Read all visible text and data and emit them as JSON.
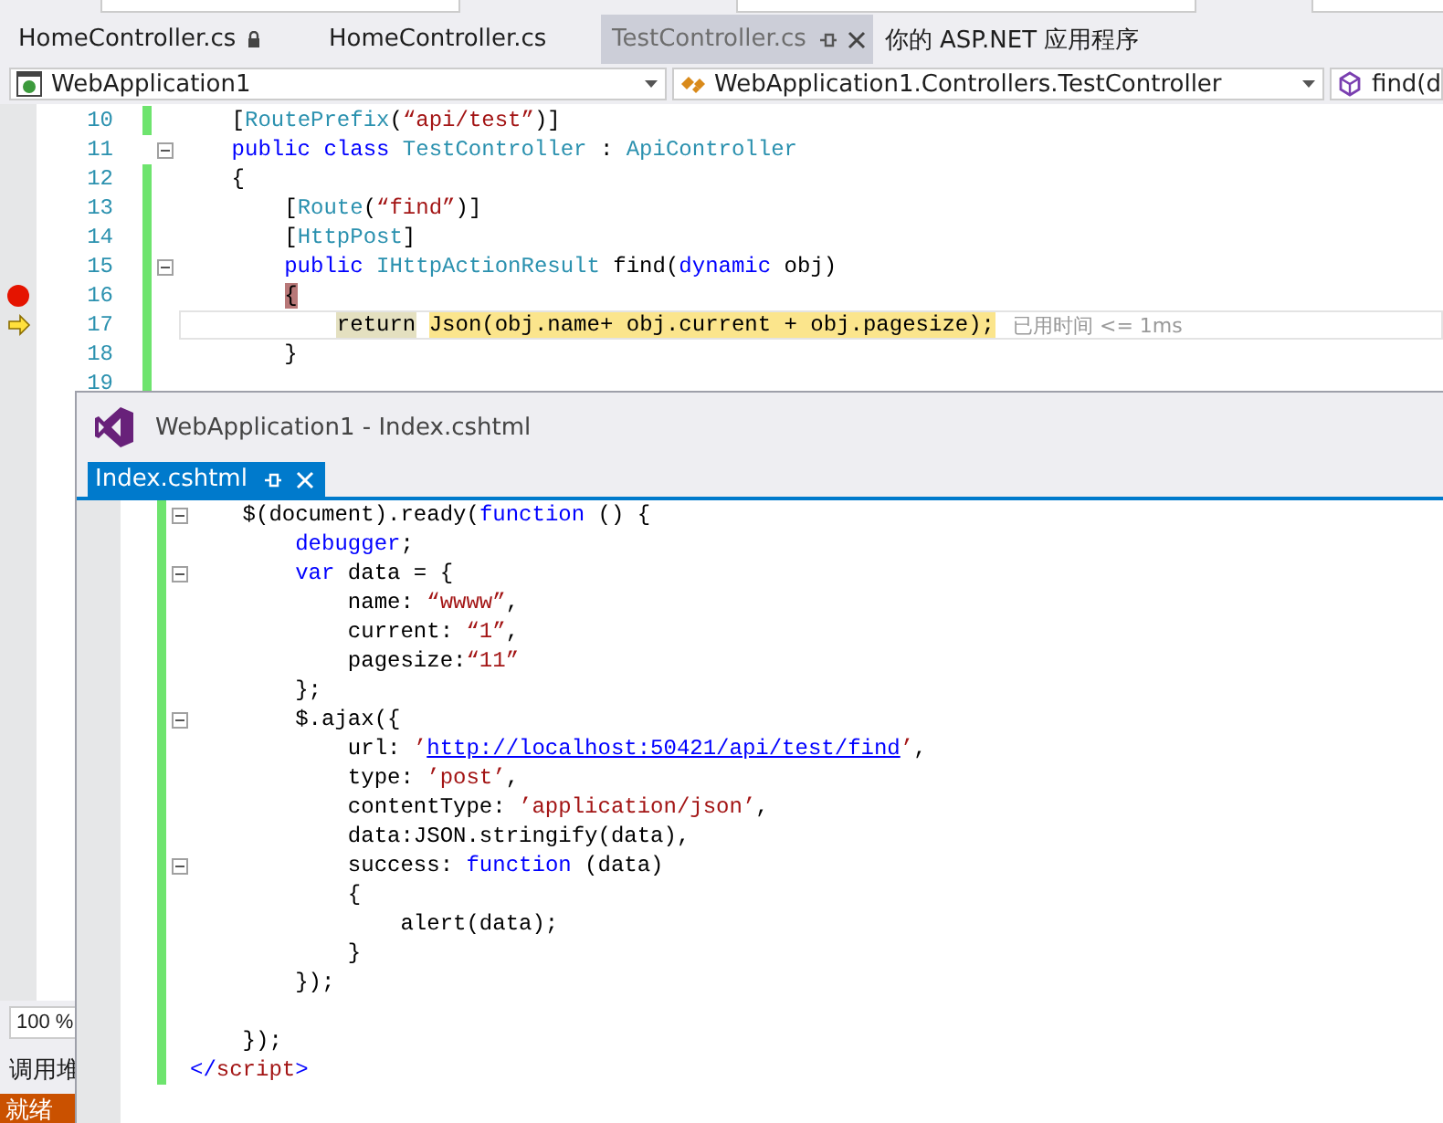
{
  "top_tabs": [
    {
      "label": "HomeController.cs",
      "locked": true,
      "selected": false
    },
    {
      "label": "HomeController.cs",
      "locked": false,
      "selected": false
    },
    {
      "label": "TestController.cs",
      "locked": false,
      "selected": true
    },
    {
      "label": "你的 ASP.NET 应用程序",
      "locked": false,
      "selected": false
    }
  ],
  "nav": {
    "project": "WebApplication1",
    "type": "WebApplication1.Controllers.TestController",
    "member": "find(d"
  },
  "editor": {
    "lines": [
      {
        "number": "10",
        "changed": true,
        "fold": false,
        "breakpoint": false,
        "current": false,
        "tokens": [
          {
            "text": "    [",
            "kind": "plain"
          },
          {
            "text": "RoutePrefix",
            "kind": "type"
          },
          {
            "text": "(",
            "kind": "plain"
          },
          {
            "text": "“api/test”",
            "kind": "string"
          },
          {
            "text": ")]",
            "kind": "plain"
          }
        ]
      },
      {
        "number": "11",
        "changed": false,
        "fold": true,
        "breakpoint": false,
        "current": false,
        "tokens": [
          {
            "text": "    public class ",
            "kind": "keyword"
          },
          {
            "text": "TestController",
            "kind": "type"
          },
          {
            "text": " : ",
            "kind": "plain"
          },
          {
            "text": "ApiController",
            "kind": "type"
          }
        ]
      },
      {
        "number": "12",
        "changed": true,
        "fold": false,
        "breakpoint": false,
        "current": false,
        "tokens": [
          {
            "text": "    {",
            "kind": "plain"
          }
        ]
      },
      {
        "number": "13",
        "changed": true,
        "fold": false,
        "breakpoint": false,
        "current": false,
        "tokens": [
          {
            "text": "        [",
            "kind": "plain"
          },
          {
            "text": "Route",
            "kind": "type"
          },
          {
            "text": "(",
            "kind": "plain"
          },
          {
            "text": "“find”",
            "kind": "string"
          },
          {
            "text": ")]",
            "kind": "plain"
          }
        ]
      },
      {
        "number": "14",
        "changed": true,
        "fold": false,
        "breakpoint": false,
        "current": false,
        "tokens": [
          {
            "text": "        [",
            "kind": "plain"
          },
          {
            "text": "HttpPost",
            "kind": "type"
          },
          {
            "text": "]",
            "kind": "plain"
          }
        ]
      },
      {
        "number": "15",
        "changed": true,
        "fold": true,
        "breakpoint": false,
        "current": false,
        "tokens": [
          {
            "text": "        public ",
            "kind": "keyword"
          },
          {
            "text": "IHttpActionResult",
            "kind": "type"
          },
          {
            "text": " find(",
            "kind": "plain"
          },
          {
            "text": "dynamic",
            "kind": "keyword"
          },
          {
            "text": " obj)",
            "kind": "plain"
          }
        ]
      },
      {
        "number": "16",
        "changed": true,
        "fold": false,
        "breakpoint": true,
        "current": false,
        "tokens": [
          {
            "text": "        {",
            "kind": "breakpoint"
          }
        ]
      },
      {
        "number": "17",
        "changed": true,
        "fold": false,
        "breakpoint": false,
        "current": true,
        "tokens": [
          {
            "text": "            return",
            "kind": "current"
          },
          {
            "text": " Json(obj.name+ obj.current + obj.pagesize);",
            "kind": "statement"
          }
        ],
        "hint": "已用时间 <= 1ms"
      },
      {
        "number": "18",
        "changed": true,
        "fold": false,
        "breakpoint": false,
        "current": false,
        "tokens": [
          {
            "text": "        }",
            "kind": "plain"
          }
        ]
      },
      {
        "number": "19",
        "changed": true,
        "fold": false,
        "breakpoint": false,
        "current": false
      }
    ]
  },
  "zoom": "100 %",
  "panel_title": "调用堆",
  "status": "就绪",
  "float_window": {
    "title": "WebApplication1 - Index.cshtml",
    "tab": {
      "label": "Index.cshtml",
      "selected": true
    },
    "lines": [
      {
        "changed": true,
        "fold": true,
        "tokens": [
          {
            "text": "    $(document).ready(",
            "kind": "plain"
          },
          {
            "text": "function",
            "kind": "keyword"
          },
          {
            "text": " () {",
            "kind": "plain"
          }
        ]
      },
      {
        "changed": true,
        "fold": false,
        "tokens": [
          {
            "text": "        debugger",
            "kind": "keyword"
          },
          {
            "text": ";",
            "kind": "plain"
          }
        ]
      },
      {
        "changed": true,
        "fold": true,
        "tokens": [
          {
            "text": "        var",
            "kind": "keyword"
          },
          {
            "text": " data = {",
            "kind": "plain"
          }
        ]
      },
      {
        "changed": true,
        "fold": false,
        "tokens": [
          {
            "text": "            name: ",
            "kind": "plain"
          },
          {
            "text": "“wwww”",
            "kind": "string"
          },
          {
            "text": ",",
            "kind": "plain"
          }
        ]
      },
      {
        "changed": true,
        "fold": false,
        "tokens": [
          {
            "text": "            current: ",
            "kind": "plain"
          },
          {
            "text": "“1”",
            "kind": "string"
          },
          {
            "text": ",",
            "kind": "plain"
          }
        ]
      },
      {
        "changed": true,
        "fold": false,
        "tokens": [
          {
            "text": "            pagesize:",
            "kind": "plain"
          },
          {
            "text": "“11”",
            "kind": "string"
          }
        ]
      },
      {
        "changed": true,
        "fold": false,
        "tokens": [
          {
            "text": "        };",
            "kind": "plain"
          }
        ]
      },
      {
        "changed": true,
        "fold": true,
        "tokens": [
          {
            "text": "        $.ajax({",
            "kind": "plain"
          }
        ]
      },
      {
        "changed": true,
        "fold": false,
        "tokens": [
          {
            "text": "            url: ",
            "kind": "plain"
          },
          {
            "text": "’",
            "kind": "string"
          },
          {
            "text": "http://localhost:50421/api/test/find",
            "kind": "link"
          },
          {
            "text": "’",
            "kind": "string"
          },
          {
            "text": ",",
            "kind": "plain"
          }
        ]
      },
      {
        "changed": true,
        "fold": false,
        "tokens": [
          {
            "text": "            type: ",
            "kind": "plain"
          },
          {
            "text": "’post’",
            "kind": "string"
          },
          {
            "text": ",",
            "kind": "plain"
          }
        ]
      },
      {
        "changed": true,
        "fold": false,
        "tokens": [
          {
            "text": "            contentType: ",
            "kind": "plain"
          },
          {
            "text": "’application/json’",
            "kind": "string"
          },
          {
            "text": ",",
            "kind": "plain"
          }
        ]
      },
      {
        "changed": true,
        "fold": false,
        "tokens": [
          {
            "text": "            data:JSON.stringify(data),",
            "kind": "plain"
          }
        ]
      },
      {
        "changed": true,
        "fold": true,
        "tokens": [
          {
            "text": "            success: ",
            "kind": "plain"
          },
          {
            "text": "function",
            "kind": "keyword"
          },
          {
            "text": " (data)",
            "kind": "plain"
          }
        ]
      },
      {
        "changed": true,
        "fold": false,
        "tokens": [
          {
            "text": "            {",
            "kind": "plain"
          }
        ]
      },
      {
        "changed": true,
        "fold": false,
        "tokens": [
          {
            "text": "                alert(data);",
            "kind": "plain"
          }
        ]
      },
      {
        "changed": true,
        "fold": false,
        "tokens": [
          {
            "text": "            }",
            "kind": "plain"
          }
        ]
      },
      {
        "changed": true,
        "fold": false,
        "tokens": [
          {
            "text": "        });",
            "kind": "plain"
          }
        ]
      },
      {
        "changed": true,
        "fold": false
      },
      {
        "changed": true,
        "fold": false,
        "tokens": [
          {
            "text": "    });",
            "kind": "plain"
          }
        ]
      },
      {
        "changed": true,
        "fold": false,
        "tokens": [
          {
            "text": "</",
            "kind": "keyword"
          },
          {
            "text": "script",
            "kind": "string"
          },
          {
            "text": ">",
            "kind": "keyword"
          }
        ]
      }
    ]
  }
}
